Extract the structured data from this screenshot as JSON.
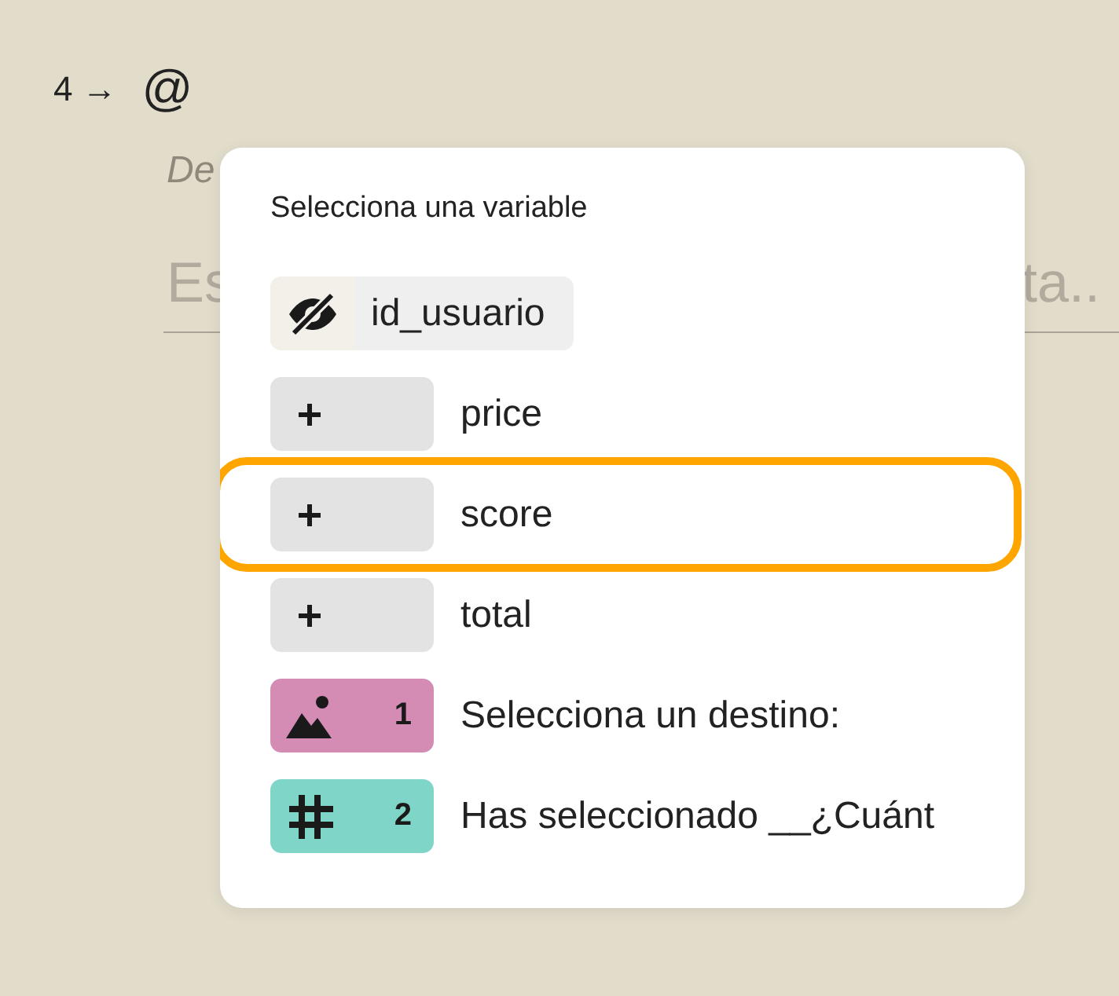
{
  "editor": {
    "step": "4",
    "arrow": "→",
    "mention": "@",
    "description": "De",
    "field_start": "Es",
    "field_end": "ta.."
  },
  "menu": {
    "title": "Selecciona una variable",
    "items": [
      {
        "kind": "hidden",
        "label": "id_usuario",
        "selected": false
      },
      {
        "kind": "add",
        "label": "price",
        "selected": false
      },
      {
        "kind": "add",
        "label": "score",
        "selected": true
      },
      {
        "kind": "add",
        "label": "total",
        "selected": false
      },
      {
        "kind": "image",
        "number": "1",
        "label": "Selecciona un destino:",
        "color": "#d48bb4",
        "selected": false
      },
      {
        "kind": "number",
        "number": "2",
        "label": "Has seleccionado __¿Cuánt",
        "color": "#7fd6c8",
        "selected": false
      }
    ]
  }
}
